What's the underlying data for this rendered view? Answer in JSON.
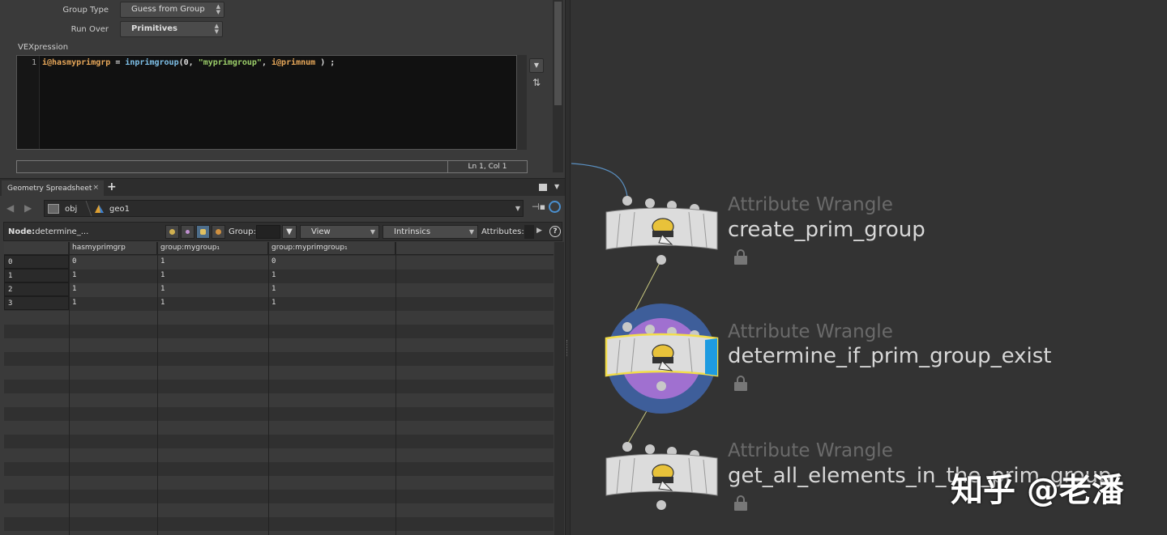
{
  "params": {
    "group_type_label": "Group Type",
    "group_type_value": "Guess from Group",
    "run_over_label": "Run Over",
    "run_over_value": "Primitives",
    "vex_label": "VEXpression",
    "code_line_number": "1",
    "code": {
      "t1": "i@hasmyprimgrp",
      "t2": " = ",
      "t3": "inprimgroup",
      "t4": "(0, ",
      "t5": "\"myprimgroup\"",
      "t6": ", ",
      "t7": "i@primnum",
      "t8": " ) ;"
    },
    "cursor_pos": "Ln 1, Col 1"
  },
  "spreadsheet": {
    "tab_label": "Geometry Spreadsheet",
    "path_obj": "obj",
    "path_geo": "geo1",
    "node_label": "Node:",
    "node_value": "determine_...",
    "group_label": "Group:",
    "view_label": "View",
    "intrinsics_label": "Intrinsics",
    "attributes_label": "Attributes:",
    "columns": [
      "hasmyprimgrp",
      "group:mygroup₁",
      "group:myprimgroup₁"
    ],
    "rows": [
      {
        "index": "0",
        "values": [
          "0",
          "1",
          "0"
        ]
      },
      {
        "index": "1",
        "values": [
          "1",
          "1",
          "1"
        ]
      },
      {
        "index": "2",
        "values": [
          "1",
          "1",
          "1"
        ]
      },
      {
        "index": "3",
        "values": [
          "1",
          "1",
          "1"
        ]
      }
    ]
  },
  "network": {
    "nodes": [
      {
        "type": "Attribute Wrangle",
        "name": "create_prim_group"
      },
      {
        "type": "Attribute Wrangle",
        "name": "determine_if_prim_group_exist"
      },
      {
        "type": "Attribute Wrangle",
        "name": "get_all_elements_in_the_prim_group"
      }
    ],
    "accent_color": "#f2dd4a",
    "display_flag_color": "#1e9be0",
    "template_ring_color": "#3e5e9a",
    "highlight_ring_color": "#a070d0"
  },
  "watermark": "知乎 @老潘"
}
